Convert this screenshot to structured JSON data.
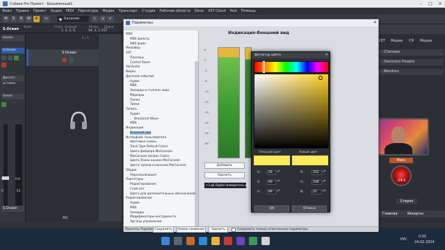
{
  "window": {
    "title": "Cubase Pro Проект - Безымянный1"
  },
  "menu": [
    "Файл",
    "Правка",
    "Проект",
    "Аудио",
    "MIDI",
    "Партитуры",
    "Медиа",
    "Транспорт",
    "Студия",
    "Рабочие области",
    "Окно",
    "VST Cloud",
    "Hub",
    "Помощь"
  ],
  "toolbar": {
    "buttons": [
      "M",
      "S",
      "R",
      "W",
      "A"
    ],
    "select_label": "Касание",
    "position_labels": [
      "Файл",
      "Старт. позиция",
      "Конец",
      "Длина",
      "Смещение"
    ],
    "position_values": [
      "1. 1. 1.  0",
      "54. 3. 1.117"
    ],
    "right_labels": [
      "резкие",
      "Авторитеты",
      "elastique Pro - Time"
    ]
  },
  "inspector": {
    "track_name": "S.Ocean",
    "rows": [
      "Канал",
      "S.Ocean",
      "Диспет. вставок",
      "Sends"
    ],
    "value_left": "0.00",
    "value_right": "0.0",
    "value_bottom_left": "0",
    "value_bottom_right": "-53",
    "bottom_name": "S.Ocean"
  },
  "tracklist": {
    "track_title": "S.Ocean",
    "counter": "1 / 1",
    "bottom_label": "AQ"
  },
  "right_panel": {
    "tabs": [
      "VST",
      "Медиа",
      "CR",
      "Медиа"
    ],
    "sections": [
      "Channels",
      "Dommino Presets",
      "Monitors"
    ],
    "mix_label": "Микс",
    "knob_value": "-14.1",
    "badge_bottom": "Стерео",
    "bottom_tabs": [
      "Главная",
      "Инсерты"
    ]
  },
  "dialog": {
    "title": "Параметры",
    "header": "Индикация-Внешний вид",
    "tree": [
      {
        "label": "MIDI",
        "indent": 0
      },
      {
        "label": "MIDI фильтр",
        "indent": 1
      },
      {
        "label": "MIDI файл",
        "indent": 1
      },
      {
        "label": "MediaBay",
        "indent": 0
      },
      {
        "label": "VST",
        "indent": 0
      },
      {
        "label": "Плагины",
        "indent": 1
      },
      {
        "label": "Control Room",
        "indent": 1
      },
      {
        "label": "VariAudio",
        "indent": 0
      },
      {
        "label": "Видео",
        "indent": 0
      },
      {
        "label": "Дисплей событий",
        "indent": 0
      },
      {
        "label": "Аудио",
        "indent": 1
      },
      {
        "label": "MIDI",
        "indent": 1
      },
      {
        "label": "Аккорды и ступени лада",
        "indent": 1
      },
      {
        "label": "Маркеры",
        "indent": 1
      },
      {
        "label": "Папки",
        "indent": 1
      },
      {
        "label": "Треки",
        "indent": 1
      },
      {
        "label": "Запись",
        "indent": 0
      },
      {
        "label": "Аудио",
        "indent": 1
      },
      {
        "label": "Broadcast Wave",
        "indent": 2
      },
      {
        "label": "MIDI",
        "indent": 1
      },
      {
        "label": "Индикация",
        "indent": 0
      },
      {
        "label": "Внешний вид",
        "indent": 1,
        "selected": true
      },
      {
        "label": "Интерфейс пользователя",
        "indent": 0
      },
      {
        "label": "Цветовые схемы",
        "indent": 1
      },
      {
        "label": "Track Type Default Colors",
        "indent": 1
      },
      {
        "label": "Цвета фейдера MixConsole",
        "indent": 1
      },
      {
        "label": "MixConsole Section Colors",
        "indent": 1
      },
      {
        "label": "Цвета Ячеек канала MixConsole",
        "indent": 1
      },
      {
        "label": "Цвета треков и каналов MixConsole",
        "indent": 1
      },
      {
        "label": "Общие",
        "indent": 0
      },
      {
        "label": "Персонализация",
        "indent": 1
      },
      {
        "label": "Партитуры",
        "indent": 0
      },
      {
        "label": "Редактирование",
        "indent": 1
      },
      {
        "label": "Слой нот",
        "indent": 1
      },
      {
        "label": "Цвета для дополнительных обозначений",
        "indent": 1
      },
      {
        "label": "Редактирование",
        "indent": 0
      },
      {
        "label": "Аудио",
        "indent": 1
      },
      {
        "label": "MIDI",
        "indent": 1
      },
      {
        "label": "Аккорды",
        "indent": 1
      },
      {
        "label": "Модификаторы инструмента",
        "indent": 1
      },
      {
        "label": "Органы управления",
        "indent": 1
      }
    ],
    "ticks": [
      "6",
      "0",
      "-3",
      "-6",
      "-10",
      "-20",
      "-30",
      "-40",
      "-50",
      "-60"
    ],
    "tag_value": "0.0",
    "add_button": "Добавить",
    "delete_button": "Удалить",
    "info_text": "+3 дБ Digital (измеритель канала",
    "footer": {
      "presets_label": "Пресеты Параметров",
      "save_button": "Сохранить",
      "new_name_button": "Новое название",
      "delete_button": "Удалить",
      "checkbox_label": "Сохранить только отмеченные параметры"
    }
  },
  "picker": {
    "title": "Детектор цвета",
    "current_label": "Текущий цвет",
    "new_label": "Новый цвет",
    "current_color": "#fcec5a",
    "new_color": "#fcec5a",
    "hsv_labels": [
      "H:",
      "S:",
      "V:"
    ],
    "hsv_values": [
      "56",
      "90",
      "99"
    ],
    "rgb_labels": [
      "R:",
      "G:",
      "B:"
    ],
    "rgb_values": [
      "252",
      "236",
      "25"
    ],
    "ok_button": "OK",
    "cancel_button": "Отмена"
  },
  "taskbar": {
    "lang": "РУС",
    "time": "0:55",
    "date": "24.02.2024"
  }
}
